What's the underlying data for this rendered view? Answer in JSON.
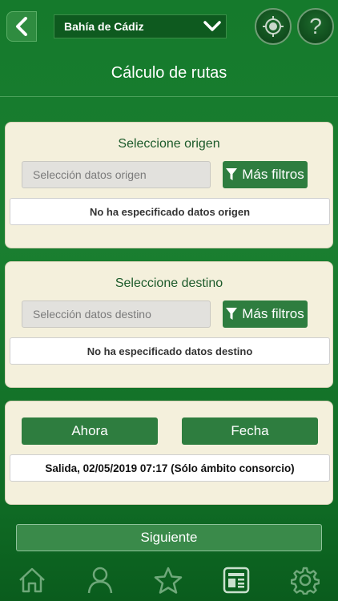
{
  "header": {
    "region": "Bahía de Cádiz",
    "help_label": "?"
  },
  "page_title": "Cálculo de rutas",
  "origin": {
    "heading": "Seleccione origen",
    "placeholder": "Selección datos origen",
    "filter_label": "Más filtros",
    "info": "No ha especificado datos origen"
  },
  "destination": {
    "heading": "Seleccione destino",
    "placeholder": "Selección datos destino",
    "filter_label": "Más filtros",
    "info": "No ha especificado datos destino"
  },
  "time": {
    "now_label": "Ahora",
    "date_label": "Fecha",
    "departure": "Salida, 02/05/2019 07:17 (Sólo ámbito consorcio)"
  },
  "next_label": "Siguiente",
  "nav": [
    "home-icon",
    "user-icon",
    "star-icon",
    "news-icon",
    "gear-icon"
  ],
  "colors": {
    "primary_green": "#2e7d3f",
    "card_bg": "#f4f0dc",
    "heading_green": "#1c5a2a"
  }
}
